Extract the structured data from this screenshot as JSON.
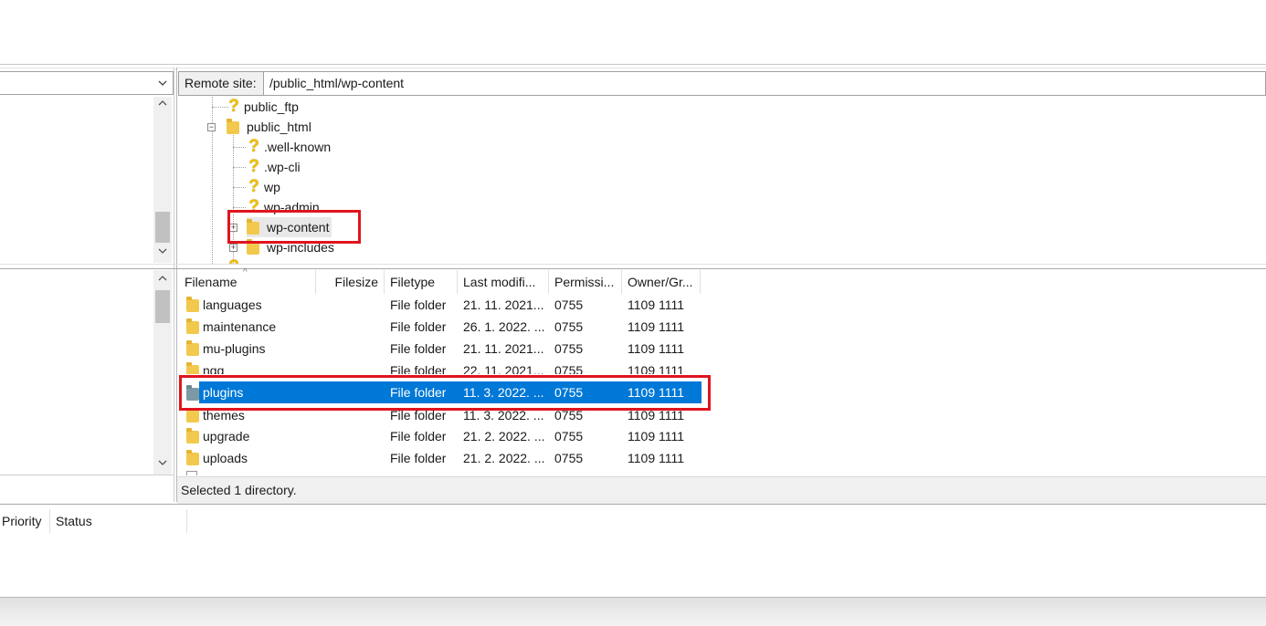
{
  "remote_site": {
    "label": "Remote site:",
    "path": "/public_html/wp-content"
  },
  "remote_tree": {
    "items": [
      {
        "label": "public_ftp",
        "icon": "question-icon"
      },
      {
        "label": "public_html",
        "icon": "folder-icon",
        "expanded": true
      },
      {
        "label": ".well-known",
        "icon": "question-icon"
      },
      {
        "label": ".wp-cli",
        "icon": "question-icon"
      },
      {
        "label": "wp",
        "icon": "question-icon"
      },
      {
        "label": "wp-admin",
        "icon": "question-icon"
      },
      {
        "label": "wp-content",
        "icon": "folder-icon",
        "highlighted": true
      },
      {
        "label": "wp-includes",
        "icon": "folder-icon"
      }
    ]
  },
  "file_list": {
    "columns": [
      "Filename",
      "Filesize",
      "Filetype",
      "Last modifi...",
      "Permissi...",
      "Owner/Gr..."
    ],
    "rows": [
      {
        "name": "languages",
        "type": "File folder",
        "modified": "21. 11. 2021...",
        "perm": "0755",
        "owner": "1109 1111"
      },
      {
        "name": "maintenance",
        "type": "File folder",
        "modified": "26. 1. 2022. ...",
        "perm": "0755",
        "owner": "1109 1111"
      },
      {
        "name": "mu-plugins",
        "type": "File folder",
        "modified": "21. 11. 2021...",
        "perm": "0755",
        "owner": "1109 1111"
      },
      {
        "name": "ngg",
        "type": "File folder",
        "modified": "22. 11. 2021...",
        "perm": "0755",
        "owner": "1109 1111"
      },
      {
        "name": "plugins",
        "type": "File folder",
        "modified": "11. 3. 2022. ...",
        "perm": "0755",
        "owner": "1109 1111",
        "selected": true
      },
      {
        "name": "themes",
        "type": "File folder",
        "modified": "11. 3. 2022. ...",
        "perm": "0755",
        "owner": "1109 1111"
      },
      {
        "name": "upgrade",
        "type": "File folder",
        "modified": "21. 2. 2022. ...",
        "perm": "0755",
        "owner": "1109 1111"
      },
      {
        "name": "uploads",
        "type": "File folder",
        "modified": "21. 2. 2022. ...",
        "perm": "0755",
        "owner": "1109 1111"
      }
    ]
  },
  "status": "Selected 1 directory.",
  "queue": {
    "columns": [
      "Priority",
      "Status"
    ]
  },
  "colors": {
    "selection": "#0078d7",
    "highlight_box": "#e0141e",
    "folder": "#f2c94c"
  }
}
